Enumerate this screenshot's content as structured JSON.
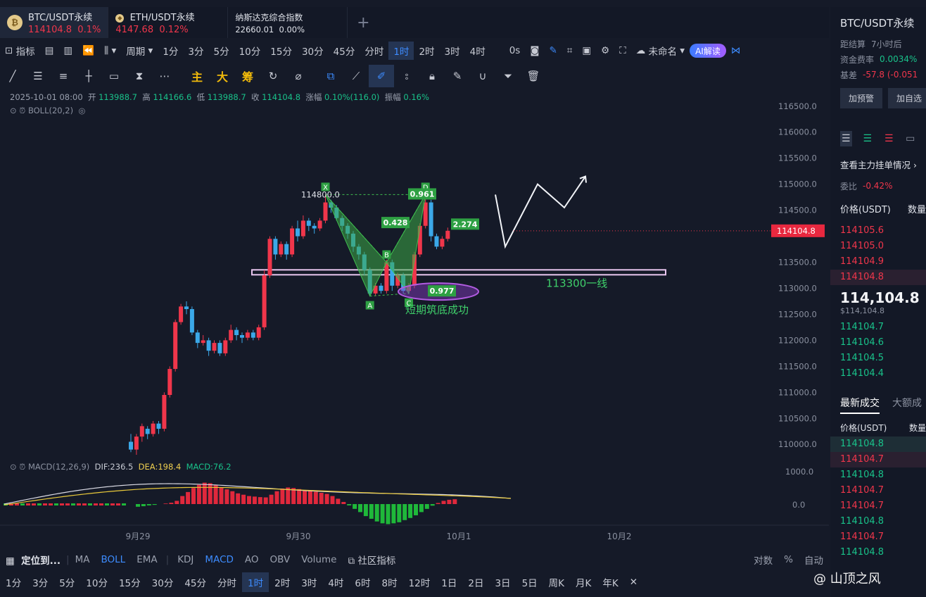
{
  "tabs": [
    {
      "name": "BTC/USDT永续",
      "price": "114104.8",
      "change": "0.1%",
      "icon": "btc-coin-icon"
    },
    {
      "name": "ETH/USDT永续",
      "price": "4147.68",
      "change": "0.12%",
      "icon": "eth-coin-icon"
    },
    {
      "name": "纳斯达克综合指数",
      "price": "22660.01",
      "change": "0.00%"
    }
  ],
  "tab_add": "+",
  "toolbar1": {
    "indicators": "指标",
    "period": "周期",
    "intervals": [
      "1分",
      "3分",
      "5分",
      "10分",
      "15分",
      "30分",
      "45分",
      "分时",
      "1时",
      "2时",
      "3时",
      "4时"
    ],
    "active_interval": "1时",
    "countdown": "0s",
    "layout_name": "未命名",
    "ai_button": "AI解读"
  },
  "toolbar2": {
    "main": "主",
    "big": "大",
    "chips": "筹"
  },
  "chart_info": {
    "datetime": "2025-10-01 08:00",
    "open_label": "开",
    "open": "113988.7",
    "high_label": "高",
    "high": "114166.6",
    "low_label": "低",
    "low": "113988.7",
    "close_label": "收",
    "close": "114104.8",
    "change_label": "涨幅",
    "change": "0.10%(116.0)",
    "amp_label": "振幅",
    "amp": "0.16%",
    "boll": "BOLL(20,2)",
    "macd_name": "MACD(12,26,9)",
    "dif": "DIF:236.5",
    "dea": "DEA:198.4",
    "macd": "MACD:76.2"
  },
  "chart_data": {
    "type": "candlestick",
    "price_axis": [
      "116500.0",
      "116000.0",
      "115500.0",
      "115000.0",
      "114500.0",
      "113500.0",
      "113000.0",
      "112500.0",
      "112000.0",
      "111500.0",
      "111000.0",
      "110500.0",
      "110000.0"
    ],
    "price_range": [
      109800,
      116700
    ],
    "macd_axis": [
      "1000.0",
      "0.0"
    ],
    "x_labels": [
      "9月29",
      "9月30",
      "10月1",
      "10月2"
    ],
    "last_price": "114104.8",
    "annotations": {
      "high_label": "114800.0",
      "xd_ratio": "0.961",
      "xb_ratio": "0.428",
      "bd_ratio": "2.274",
      "ac_ratio": "0.977",
      "points": [
        "X",
        "A",
        "B",
        "C",
        "D"
      ],
      "support_label": "113300一线",
      "bottom_label": "短期筑底成功",
      "support_level": 113300
    },
    "candles": [
      [
        110050,
        109900,
        110200,
        109850
      ],
      [
        109900,
        110150,
        110200,
        109800
      ],
      [
        110150,
        110350,
        110400,
        110050
      ],
      [
        110300,
        110200,
        110350,
        110100
      ],
      [
        110200,
        110400,
        110450,
        110150
      ],
      [
        110400,
        110300,
        110450,
        110200
      ],
      [
        110300,
        110950,
        111000,
        110250
      ],
      [
        110950,
        111450,
        111500,
        110900
      ],
      [
        111450,
        112350,
        112400,
        111400
      ],
      [
        112350,
        112650,
        112700,
        112300
      ],
      [
        112650,
        112600,
        112750,
        112500
      ],
      [
        112600,
        112150,
        112650,
        112100
      ],
      [
        112150,
        111950,
        112200,
        111850
      ],
      [
        111950,
        112000,
        112100,
        111900
      ],
      [
        112000,
        111800,
        112050,
        111700
      ],
      [
        111800,
        111950,
        112000,
        111750
      ],
      [
        111950,
        111750,
        112000,
        111700
      ],
      [
        111750,
        112000,
        112050,
        111700
      ],
      [
        112000,
        112200,
        112300,
        111950
      ],
      [
        112200,
        112100,
        112250,
        112000
      ],
      [
        112100,
        112050,
        112150,
        111950
      ],
      [
        112050,
        112150,
        112200,
        112000
      ],
      [
        112150,
        112050,
        112200,
        112000
      ],
      [
        112050,
        112250,
        112300,
        112000
      ],
      [
        112250,
        113250,
        113350,
        112200
      ],
      [
        113250,
        113950,
        114000,
        113200
      ],
      [
        113950,
        113650,
        114000,
        113550
      ],
      [
        113650,
        113850,
        113900,
        113600
      ],
      [
        113850,
        113650,
        113900,
        113550
      ],
      [
        113650,
        114150,
        114200,
        113600
      ],
      [
        114150,
        114000,
        114300,
        113900
      ],
      [
        114000,
        114300,
        114400,
        113950
      ],
      [
        114300,
        114200,
        114350,
        114100
      ],
      [
        114200,
        114150,
        114250,
        114050
      ],
      [
        114150,
        114300,
        114350,
        114100
      ],
      [
        114300,
        114650,
        114800,
        114250
      ],
      [
        114650,
        114550,
        114700,
        114450
      ],
      [
        114550,
        114350,
        114600,
        114300
      ],
      [
        114350,
        114200,
        114400,
        114100
      ],
      [
        114200,
        114050,
        114250,
        113950
      ],
      [
        114050,
        113800,
        114100,
        113700
      ],
      [
        113800,
        113650,
        113850,
        113550
      ],
      [
        113650,
        113350,
        113700,
        113250
      ],
      [
        113350,
        112900,
        113400,
        112850
      ],
      [
        112900,
        113050,
        113100,
        112850
      ],
      [
        113050,
        112950,
        113100,
        112900
      ],
      [
        112950,
        113500,
        113550,
        112900
      ],
      [
        113500,
        113050,
        113550,
        112950
      ],
      [
        113050,
        113250,
        113300,
        113000
      ],
      [
        113250,
        112950,
        113300,
        112900
      ],
      [
        112950,
        113050,
        113100,
        112900
      ],
      [
        113050,
        113650,
        113700,
        113000
      ],
      [
        113650,
        114200,
        114250,
        113600
      ],
      [
        114200,
        114650,
        114800,
        114150
      ],
      [
        114650,
        114000,
        114700,
        113900
      ],
      [
        114000,
        113800,
        114050,
        113750
      ],
      [
        113800,
        113950,
        114000,
        113750
      ],
      [
        113950,
        114105,
        114166,
        113900
      ]
    ],
    "macd_hist": [
      -10,
      -8,
      -5,
      -3,
      0,
      2,
      5,
      12,
      30,
      45,
      60,
      72,
      80,
      78,
      70,
      62,
      55,
      48,
      40,
      35,
      30,
      28,
      26,
      25,
      35,
      48,
      58,
      62,
      60,
      56,
      52,
      50,
      46,
      42,
      38,
      30,
      20,
      8,
      -5,
      -18,
      -30,
      -45,
      -55,
      -65,
      -72,
      -75,
      -72,
      -68,
      -60,
      -52,
      -42,
      -30,
      -18,
      -6,
      4,
      12,
      16,
      18
    ],
    "projection": [
      [
        114150,
        113800
      ],
      [
        114500,
        114600
      ],
      [
        114700,
        114800
      ],
      [
        114900,
        115100
      ],
      [
        115000,
        114800
      ],
      [
        115200,
        115300
      ]
    ]
  },
  "bottom1": {
    "locate": "定位到...",
    "indicators": [
      "MA",
      "BOLL",
      "EMA",
      "KDJ",
      "MACD",
      "AO",
      "OBV",
      "Volume"
    ],
    "active": [
      "BOLL",
      "MACD"
    ],
    "community": "社区指标",
    "right": [
      "对数",
      "%",
      "自动"
    ]
  },
  "bottom2": {
    "intervals": [
      "1分",
      "3分",
      "5分",
      "10分",
      "15分",
      "30分",
      "45分",
      "分时",
      "1时",
      "2时",
      "3时",
      "4时",
      "6时",
      "8时",
      "12时",
      "1日",
      "2日",
      "3日",
      "5日",
      "周K",
      "月K",
      "年K"
    ],
    "active": "1时",
    "close": "✕"
  },
  "right_panel": {
    "title": "BTC/USDT永续",
    "settle_label": "距结算",
    "settle_value": "7小时后",
    "funding_label": "资金费率",
    "funding_value": "0.0034%",
    "basis_label": "基差",
    "basis_value": "-57.8 (-0.051",
    "btn_alert": "加预警",
    "btn_watch": "加自选",
    "link": "查看主力挂单情况",
    "ratio_label": "委比",
    "ratio_value": "-0.42%",
    "ob_head_price": "价格(USDT)",
    "ob_head_qty": "数量",
    "asks": [
      "114105.6",
      "114105.0",
      "114104.9",
      "114104.8"
    ],
    "big_price": "114,104.8",
    "sub_price": "$114,104.8",
    "bids": [
      "114104.7",
      "114104.6",
      "114104.5",
      "114104.4"
    ],
    "trades_tab1": "最新成交",
    "trades_tab2": "大额成",
    "trades_head_price": "价格(USDT)",
    "trades_head_qty": "数量",
    "trades": [
      {
        "p": "114104.8",
        "side": "buy"
      },
      {
        "p": "114104.7",
        "side": "sell"
      },
      {
        "p": "114104.8",
        "side": "buy"
      },
      {
        "p": "114104.7",
        "side": "sell"
      },
      {
        "p": "114104.7",
        "side": "sell"
      },
      {
        "p": "114104.8",
        "side": "buy"
      },
      {
        "p": "114104.7",
        "side": "sell"
      },
      {
        "p": "114104.8",
        "side": "buy"
      }
    ]
  },
  "watermark": "@ 山顶之风",
  "colors": {
    "up": "#f0364b",
    "down": "#19c28a",
    "blue": "#3d8cff",
    "bg": "#151a28"
  }
}
